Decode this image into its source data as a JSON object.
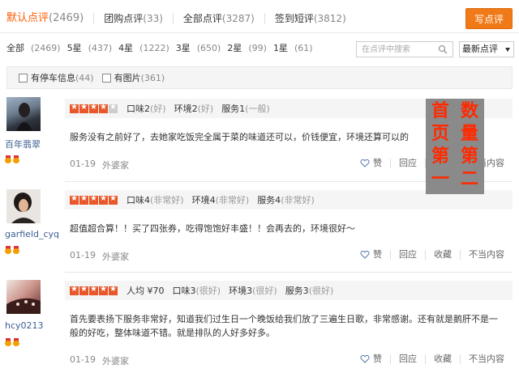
{
  "tabs": [
    {
      "label": "默认点评",
      "count": "(2469)",
      "active": true
    },
    {
      "label": "团购点评",
      "count": "(33)"
    },
    {
      "label": "全部点评",
      "count": "(3287)"
    },
    {
      "label": "签到短评",
      "count": "(3812)"
    }
  ],
  "write_button": "写点评",
  "star_filters": [
    {
      "label": "全部",
      "count": "(2469)"
    },
    {
      "label": "5星",
      "count": "(437)"
    },
    {
      "label": "4星",
      "count": "(1222)"
    },
    {
      "label": "3星",
      "count": "(650)"
    },
    {
      "label": "2星",
      "count": "(99)"
    },
    {
      "label": "1星",
      "count": "(61)"
    }
  ],
  "search": {
    "placeholder": "在点评中搜索"
  },
  "sort": {
    "selected": "最新点评"
  },
  "filters": [
    {
      "label": "有停车信息",
      "count": "(44)"
    },
    {
      "label": "有图片",
      "count": "(361)"
    }
  ],
  "reviews": [
    {
      "user": "百年翡翠",
      "stars": 4,
      "scores": [
        {
          "name": "口味2",
          "q": "(好)"
        },
        {
          "name": "环境2",
          "q": "(好)"
        },
        {
          "name": "服务1",
          "q": "(一般)"
        }
      ],
      "text": "服务没有之前好了，去她家吃饭完全属于菜的味道还可以，价钱便宜，环境还算可以的",
      "date": "01-19",
      "store": "外婆家",
      "actions": [
        "赞",
        "回应",
        "收藏",
        "不当内容"
      ]
    },
    {
      "user": "garfield_cyq",
      "stars": 5,
      "scores": [
        {
          "name": "口味4",
          "q": "(非常好)"
        },
        {
          "name": "环境4",
          "q": "(非常好)"
        },
        {
          "name": "服务4",
          "q": "(非常好)"
        }
      ],
      "text": "超值超合算！！买了四张券，吃得饱饱好丰盛！！会再去的，环境很好～",
      "date": "01-19",
      "store": "外婆家",
      "actions": [
        "赞",
        "回应",
        "收藏",
        "不当内容"
      ]
    },
    {
      "user": "hcy0213",
      "stars": 5,
      "price": "人均 ¥70",
      "scores": [
        {
          "name": "口味3",
          "q": "(很好)"
        },
        {
          "name": "环境3",
          "q": "(很好)"
        },
        {
          "name": "服务3",
          "q": "(很好)"
        }
      ],
      "text": "首先要表扬下服务非常好，知道我们过生日一个晚饭给我们放了三遍生日歌，非常感谢。还有就是鹅肝不是一般的好吃，整体味道不错。就是排队的人好多好多。",
      "date": "01-19",
      "store": "外婆家",
      "actions": [
        "赞",
        "回应",
        "收藏",
        "不当内容"
      ]
    }
  ],
  "overlay": {
    "col1": "首页第一",
    "col2": "数量第二"
  }
}
